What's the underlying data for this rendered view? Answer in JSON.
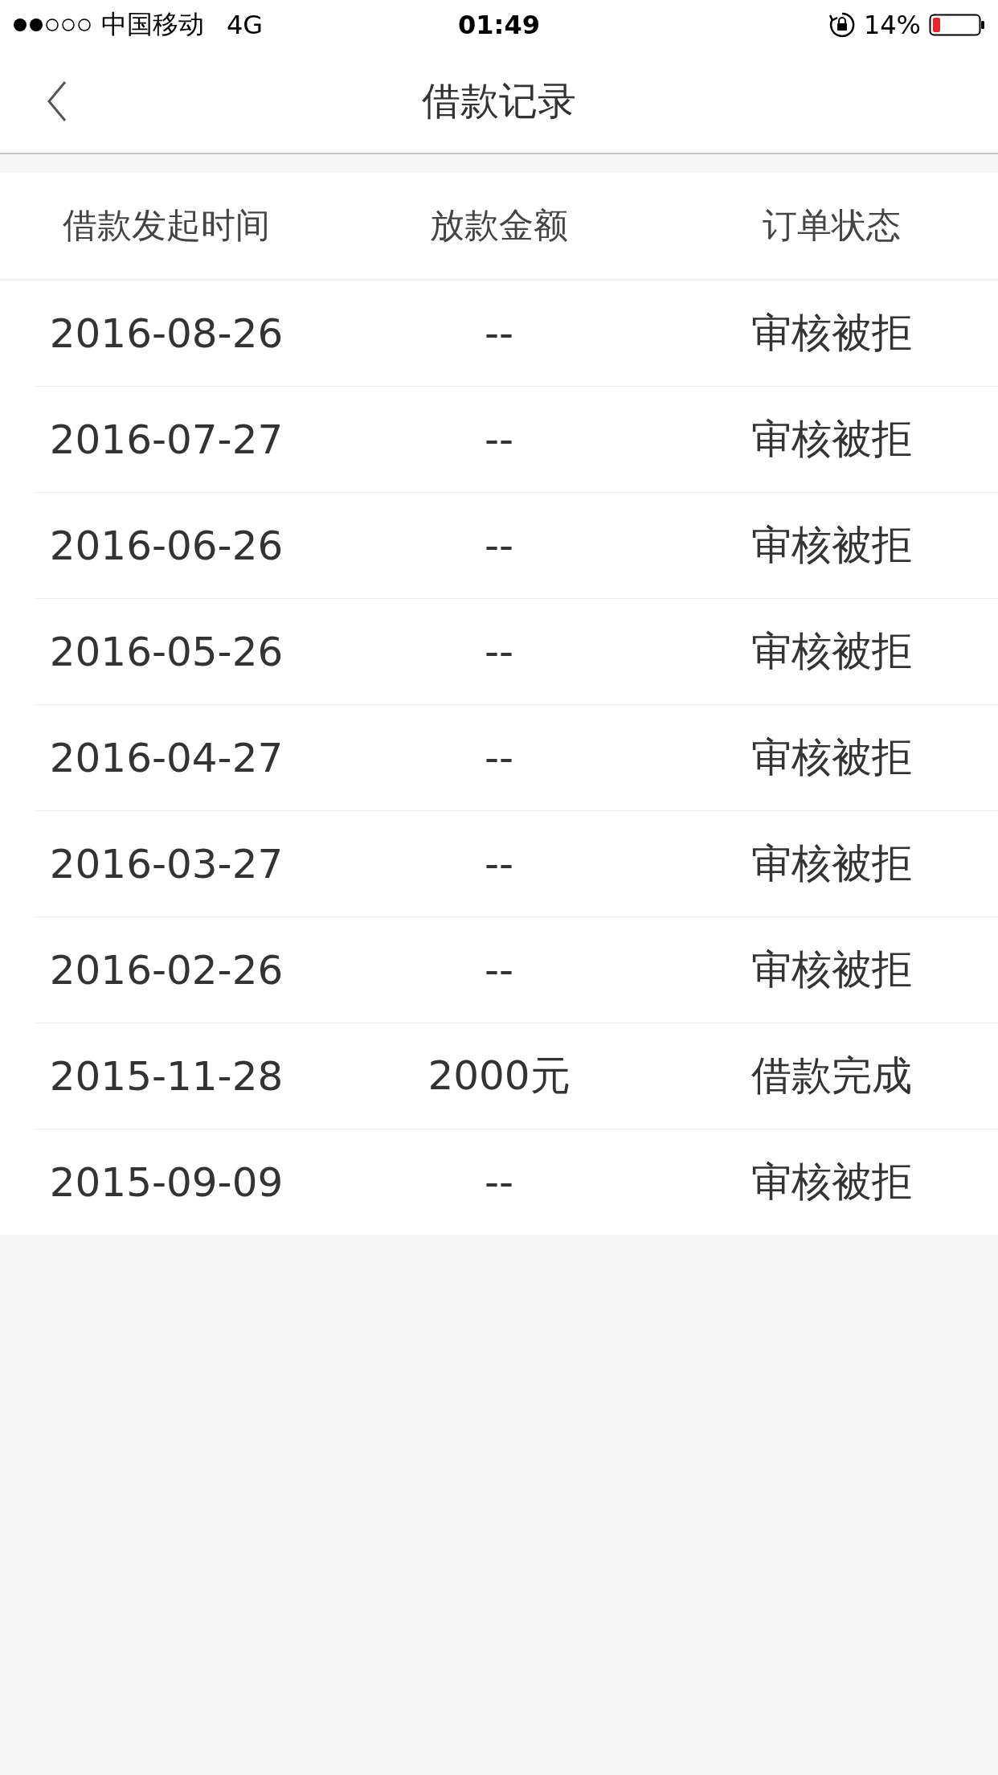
{
  "status_bar": {
    "carrier": "中国移动",
    "network": "4G",
    "time": "01:49",
    "battery_text": "14%"
  },
  "nav": {
    "title": "借款记录"
  },
  "table": {
    "columns": [
      "借款发起时间",
      "放款金额",
      "订单状态"
    ],
    "rows": [
      {
        "date": "2016-08-26",
        "amount": "--",
        "status": "审核被拒"
      },
      {
        "date": "2016-07-27",
        "amount": "--",
        "status": "审核被拒"
      },
      {
        "date": "2016-06-26",
        "amount": "--",
        "status": "审核被拒"
      },
      {
        "date": "2016-05-26",
        "amount": "--",
        "status": "审核被拒"
      },
      {
        "date": "2016-04-27",
        "amount": "--",
        "status": "审核被拒"
      },
      {
        "date": "2016-03-27",
        "amount": "--",
        "status": "审核被拒"
      },
      {
        "date": "2016-02-26",
        "amount": "--",
        "status": "审核被拒"
      },
      {
        "date": "2015-11-28",
        "amount": "2000元",
        "status": "借款完成"
      },
      {
        "date": "2015-09-09",
        "amount": "--",
        "status": "审核被拒"
      }
    ]
  }
}
